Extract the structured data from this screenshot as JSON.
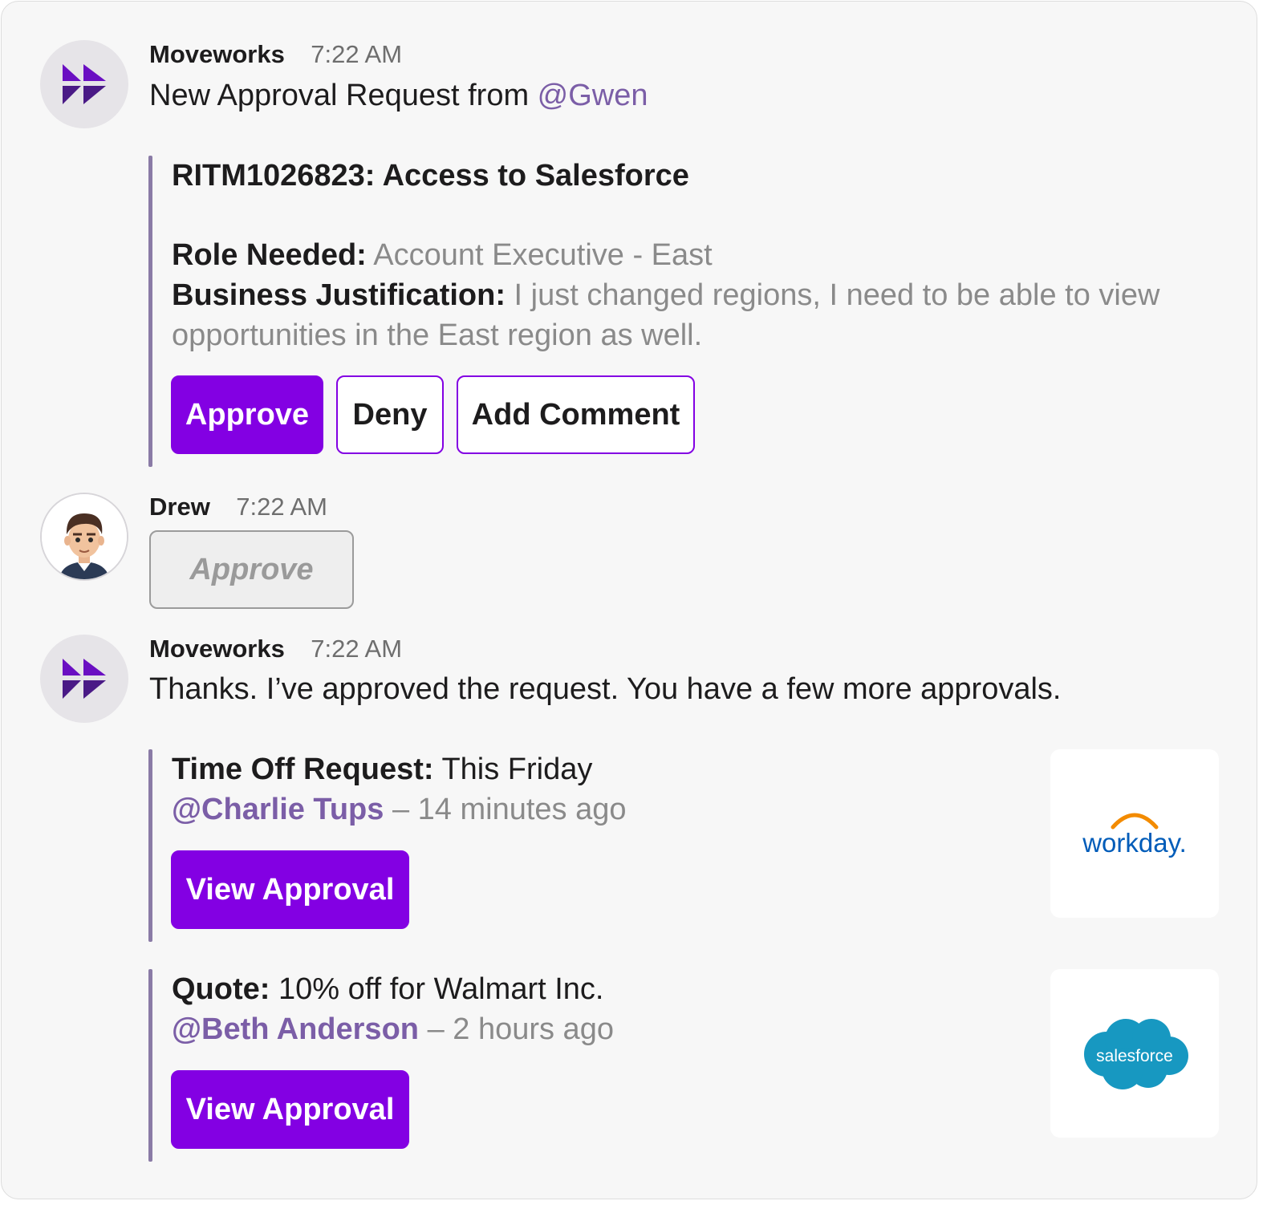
{
  "messages": [
    {
      "sender": "Moveworks",
      "time": "7:22 AM",
      "text_prefix": "New Approval Request from ",
      "mention": "@Gwen",
      "attachment": {
        "title": "RITM1026823: Access to Salesforce",
        "role_label": "Role Needed:",
        "role_value": "Account Executive - East",
        "justification_label": "Business Justification:",
        "justification_line1": "I just changed regions, I need to be able to view",
        "justification_line2": "opportunities in the East region as well.",
        "buttons": {
          "approve": "Approve",
          "deny": "Deny",
          "comment": "Add Comment"
        }
      }
    },
    {
      "sender": "Drew",
      "time": "7:22 AM",
      "reply_button": "Approve"
    },
    {
      "sender": "Moveworks",
      "time": "7:22 AM",
      "text": "Thanks. I’ve approved the request. You have a few more approvals.",
      "approvals": [
        {
          "label": "Time Off Request:",
          "value": "This Friday",
          "mention": "@Charlie Tups",
          "ago": "– 14 minutes ago",
          "button": "View Approval",
          "logo_text": "workday.",
          "logo_icon": "workday-logo-icon"
        },
        {
          "label": "Quote:",
          "value": "10% off for Walmart Inc.",
          "mention": "@Beth Anderson",
          "ago": "– 2 hours ago",
          "button": "View Approval",
          "logo_text": "salesforce",
          "logo_icon": "salesforce-logo-icon"
        }
      ]
    }
  ],
  "colors": {
    "accent": "#8300e3",
    "mention": "#7b5ea7",
    "muted": "#8a8a8a",
    "bot_logo": "#6a0fc2",
    "workday_blue": "#005cb9",
    "workday_orange": "#f38b00",
    "salesforce_blue": "#1798c1"
  }
}
